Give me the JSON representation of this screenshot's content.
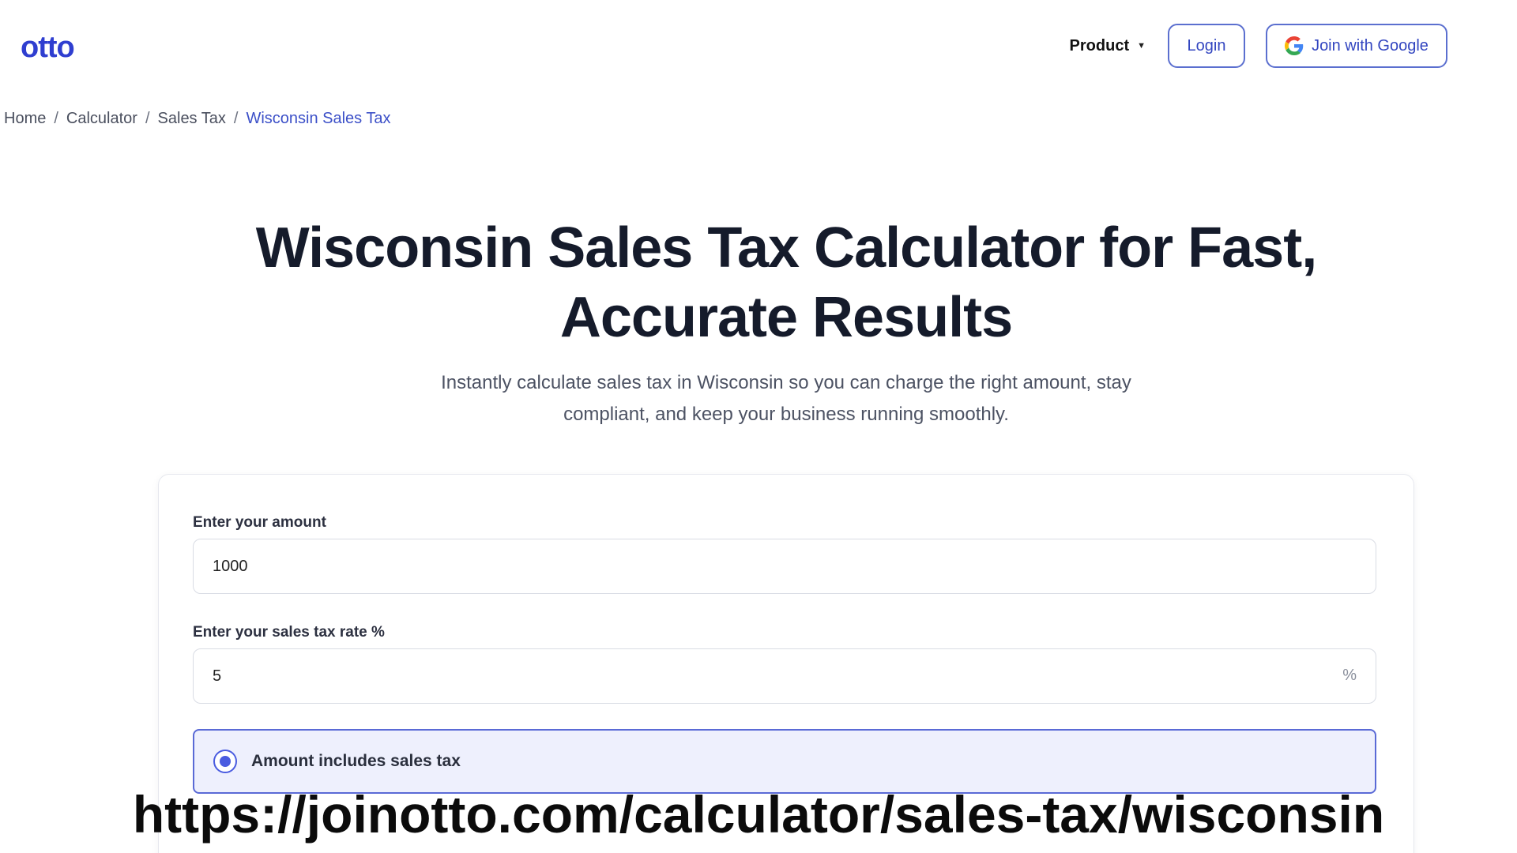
{
  "header": {
    "logo": "otto",
    "nav": {
      "product_label": "Product",
      "login_label": "Login",
      "google_label": "Join with Google"
    }
  },
  "breadcrumb": {
    "items": [
      "Home",
      "Calculator",
      "Sales Tax",
      "Wisconsin Sales Tax"
    ],
    "separator": "/"
  },
  "hero": {
    "title_line1": "Wisconsin Sales Tax Calculator for Fast,",
    "title_line2": "Accurate Results",
    "subtitle_line1": "Instantly calculate sales tax in Wisconsin so you can charge the right amount, stay",
    "subtitle_line2": "compliant, and keep your business running smoothly."
  },
  "calculator": {
    "amount_label": "Enter your amount",
    "amount_value": "1000",
    "rate_label": "Enter your sales tax rate %",
    "rate_value": "5",
    "rate_suffix": "%",
    "option_label": "Amount includes sales tax",
    "option_selected": true
  },
  "caption": {
    "url": "https://joinotto.com/calculator/sales-tax/wisconsin"
  },
  "colors": {
    "brand": "#2f3ed0",
    "accent_border": "#5a6ad6",
    "selected_bg": "#eef0fd",
    "breadcrumb_current": "#3c50c8"
  },
  "icons": {
    "product_caret": "caret-down-icon",
    "google": "google-icon",
    "radio": "radio-selected-icon"
  }
}
